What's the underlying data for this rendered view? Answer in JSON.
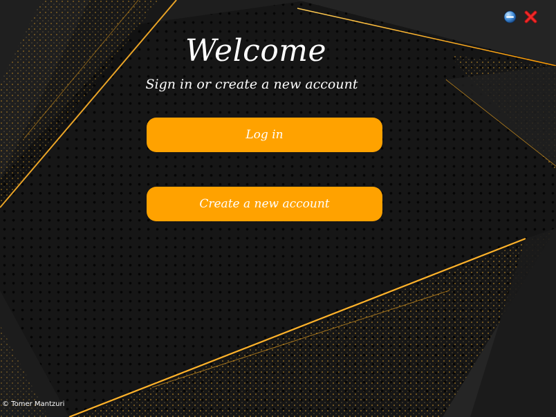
{
  "window": {
    "title": "Welcome",
    "subtitle": "Sign in or create a new account",
    "controls": {
      "minimize_icon": "minimize-icon",
      "close_icon": "close-icon"
    }
  },
  "buttons": {
    "login_label": "Log in",
    "create_account_label": "Create a new account"
  },
  "footer": {
    "copyright": "© Tomer Mantzuri"
  },
  "colors": {
    "button_background": "#ffa200",
    "button_text": "#ffffff",
    "background": "#161616",
    "accent_gold": "#ffb020",
    "close_red": "#e02020",
    "minimize_blue": "#2a6fb8"
  }
}
